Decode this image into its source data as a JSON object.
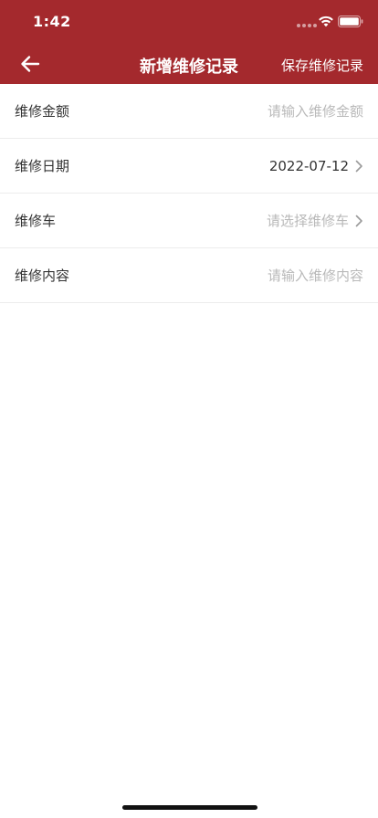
{
  "status_bar": {
    "time": "1:42"
  },
  "nav": {
    "title": "新增维修记录",
    "save_label": "保存维修记录",
    "back_icon": "arrow-left-icon"
  },
  "form": {
    "amount": {
      "label": "维修金额",
      "placeholder": "请输入维修金额"
    },
    "date": {
      "label": "维修日期",
      "value": "2022-07-12"
    },
    "vehicle": {
      "label": "维修车",
      "placeholder": "请选择维修车"
    },
    "content": {
      "label": "维修内容",
      "placeholder": "请输入维修内容"
    }
  },
  "colors": {
    "brand": "#a4292d",
    "text": "#333333",
    "placeholder": "#b9b9b9",
    "divider": "#ececec"
  }
}
